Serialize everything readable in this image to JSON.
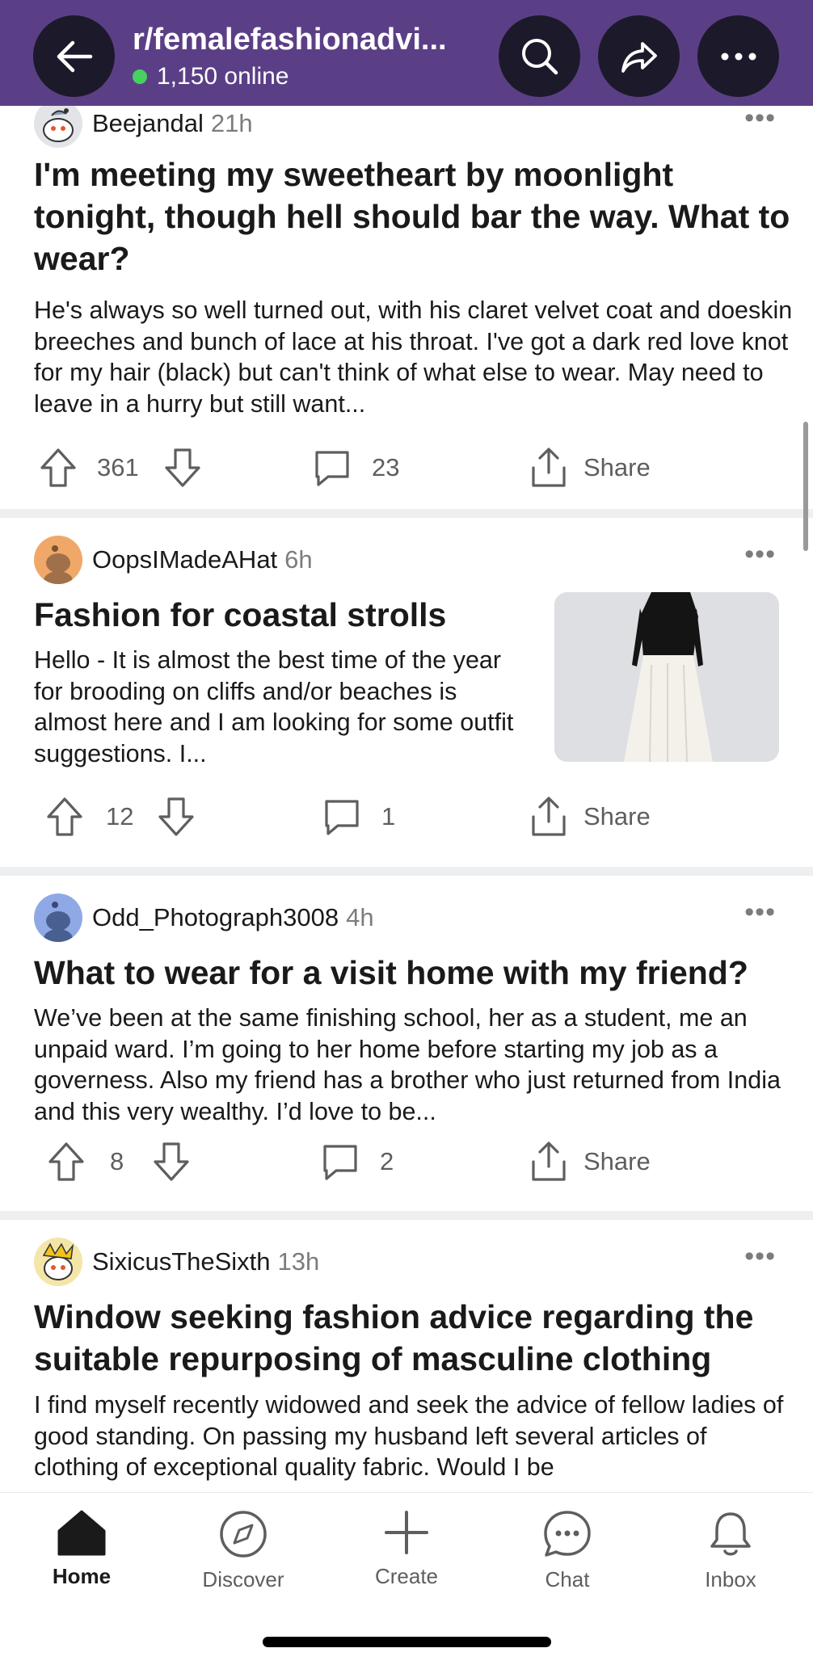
{
  "header": {
    "title": "r/femalefashionadvi...",
    "online": "1,150 online",
    "back_icon": "back-arrow-icon",
    "search_icon": "search-icon",
    "share_icon": "share-forward-icon",
    "more_icon": "more-horizontal-icon"
  },
  "posts": [
    {
      "username": "Beejandal",
      "age": "21h",
      "title": "I'm meeting my sweetheart by moonlight tonight, though hell should bar the way. What to wear?",
      "body": "He's always so well turned out, with his claret velvet coat and doeskin breeches and bunch of lace at his throat. I've got a dark red love knot for my hair (black) but can't think of what else to wear. May need to leave in a hurry but still want...",
      "votes": "361",
      "comments": "23",
      "share": "Share",
      "more": "•••"
    },
    {
      "username": "OopsIMadeAHat",
      "age": "6h",
      "title": "Fashion for coastal strolls",
      "body": "Hello - It is almost the best time of the year for brooding on cliffs and/or beaches is almost here and I am looking for some outfit suggestions. I...",
      "votes": "12",
      "comments": "1",
      "share": "Share",
      "more": "•••"
    },
    {
      "username": "Odd_Photograph3008",
      "age": "4h",
      "title": "What to wear for a visit home with my friend?",
      "body": "We’ve been at the same finishing school, her as a student, me an unpaid ward. I’m going to her home before starting my job as a governess. Also my friend has a brother who just returned from India and this very wealthy.  I’d love to be...",
      "votes": "8",
      "comments": "2",
      "share": "Share",
      "more": "•••"
    },
    {
      "username": "SixicusTheSixth",
      "age": "13h",
      "title": "Window seeking fashion advice regarding the suitable repurposing of masculine clothing",
      "body": "I find myself recently widowed and seek the advice of fellow ladies of good standing. On passing my husband left several articles of clothing of exceptional quality fabric. Would I be",
      "more": "•••"
    }
  ],
  "tabs": [
    {
      "label": "Home",
      "icon": "home-icon"
    },
    {
      "label": "Discover",
      "icon": "compass-icon"
    },
    {
      "label": "Create",
      "icon": "plus-icon"
    },
    {
      "label": "Chat",
      "icon": "chat-icon"
    },
    {
      "label": "Inbox",
      "icon": "bell-icon"
    }
  ],
  "colors": {
    "header_bg": "#5b3f86",
    "online_dot": "#46d160",
    "text": "#1a1a1b",
    "muted": "#7c7c7c"
  }
}
